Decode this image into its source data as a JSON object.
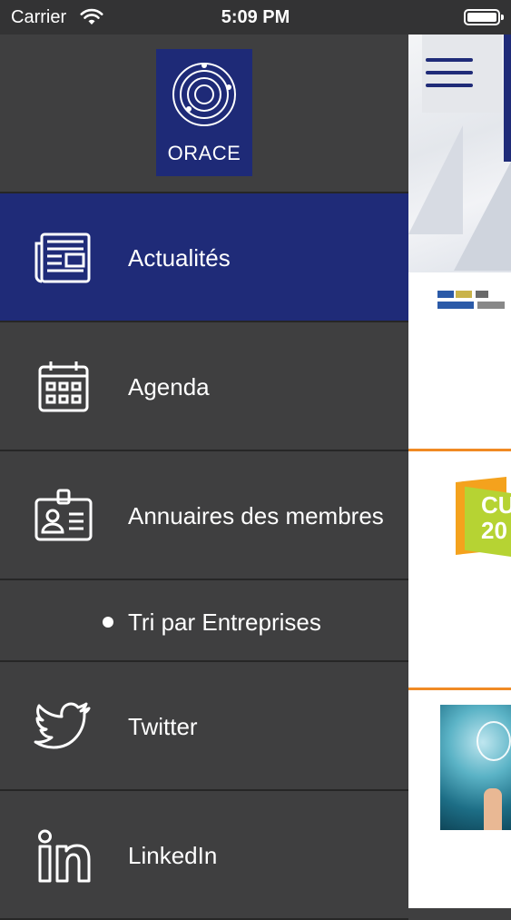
{
  "status_bar": {
    "carrier": "Carrier",
    "time": "5:09 PM",
    "battery_level": 0.95
  },
  "logo": {
    "text": "ORACE"
  },
  "menu": {
    "items": [
      {
        "label": "Actualités",
        "icon": "newspaper-icon",
        "active": true
      },
      {
        "label": "Agenda",
        "icon": "calendar-icon",
        "active": false
      },
      {
        "label": "Annuaires des membres",
        "icon": "id-badge-icon",
        "active": false
      },
      {
        "label": "Twitter",
        "icon": "twitter-icon",
        "active": false
      },
      {
        "label": "LinkedIn",
        "icon": "linkedin-icon",
        "active": false
      }
    ],
    "sub_items": [
      {
        "label": "Tri par Entreprises"
      }
    ]
  },
  "content": {
    "badge_text": "CU\n20"
  },
  "colors": {
    "drawer_bg": "#3f3f40",
    "active_bg": "#1f2b78",
    "accent_orange": "#f08a24",
    "brand_blue": "#1e2a77"
  }
}
